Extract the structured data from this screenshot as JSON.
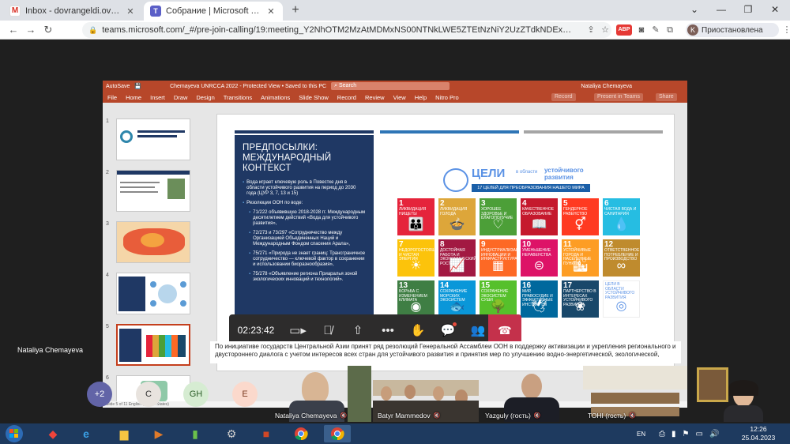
{
  "browser": {
    "tabs": [
      {
        "title": "Inbox - dovrangeldi.ovl@gmail.c",
        "favicon": "gmail-icon"
      },
      {
        "title": "Собрание | Microsoft Teams",
        "favicon": "teams-icon"
      }
    ],
    "url": "teams.microsoft.com/_#/pre-join-calling/19:meeting_Y2NhOTM2MzAtMDMxNS00NTNkLWE5ZTEtNzNiY2UzZTdkNDEx@thre...",
    "profile_initial": "K",
    "profile_label": "Приостановлена",
    "abp": "ABP"
  },
  "ppt": {
    "autosave": "AutoSave",
    "file_title": "Chemayeva UNRCCA 2022  -  Protected View  •  Saved to this PC",
    "search": "Search",
    "user": "Nataliya Chemayeva",
    "menu": [
      "File",
      "Home",
      "Insert",
      "Draw",
      "Design",
      "Transitions",
      "Animations",
      "Slide Show",
      "Record",
      "Review",
      "View",
      "Help",
      "Nitro Pro"
    ],
    "record_btn": "Record",
    "present_btn": "Present in Teams",
    "share_btn": "Share",
    "thumb_numbers": [
      "1",
      "2",
      "3",
      "4",
      "5",
      "6"
    ],
    "status": "Slide 5 of 11    English (United States)",
    "notes": "По инициативе государств Центральной Азии принят ряд резолюций Генеральной Ассамблеи ООН в поддержку активизации и укрепления регионального и двустороннего диалога с учетом интересов всех стран для устойчивого развития и принятия мер по улучшению водно-энергетической, экологической,"
  },
  "slide": {
    "title": "ПРЕДПОСЫЛКИ: МЕЖДУНАРОДНЫЙ КОНТЕКСТ",
    "bullets": [
      {
        "text": "Вода играет ключевую роль в Повестке дня в области устойчивого развития на период до 2030 года (ЦУР 3, 7, 13 и 15)",
        "sub": false
      },
      {
        "text": "Резолюции ООН по воде:",
        "sub": false
      },
      {
        "text": "71/222 объявившую 2018-2028 гг. Международным десятилетием действий «Вода для устойчивого развития»,",
        "sub": true
      },
      {
        "text": "72/273 и 73/297 «Сотрудничество между Организацией Объединенных Наций и Международным Фондом спасения Арала»,",
        "sub": true
      },
      {
        "text": "75/271 «Природа не знает границ: Трансграничное сотрудничество — ключевой фактор в сохранении и использовании биоразнообразия»,",
        "sub": true
      },
      {
        "text": "75/278 «Объявление региона Приаралья зоной экологических инноваций и технологий».",
        "sub": true
      }
    ],
    "sdg_word": "ЦЕЛИ",
    "sdg_in": "в области",
    "sdg_sust": "устойчивого развития",
    "sdg_band": "17 ЦЕЛЕЙ ДЛЯ ПРЕОБРАЗОВАНИЯ НАШЕГО МИРА",
    "goals": [
      {
        "n": "1",
        "t": "Ликвидация нищеты",
        "c": "#e5243b",
        "icon": "family-icon",
        "g": "👪"
      },
      {
        "n": "2",
        "t": "Ликвидация голода",
        "c": "#dda63a",
        "icon": "bowl-icon",
        "g": "🍲"
      },
      {
        "n": "3",
        "t": "Хорошее здоровье и благополучие",
        "c": "#4c9f38",
        "icon": "heartbeat-icon",
        "g": "♡"
      },
      {
        "n": "4",
        "t": "Качественное образование",
        "c": "#c5192d",
        "icon": "book-icon",
        "g": "📖"
      },
      {
        "n": "5",
        "t": "Гендерное равенство",
        "c": "#ff3a21",
        "icon": "gender-icon",
        "g": "⚥"
      },
      {
        "n": "6",
        "t": "Чистая вода и санитария",
        "c": "#26bde2",
        "icon": "water-icon",
        "g": "💧"
      },
      {
        "n": "7",
        "t": "Недорогостоящая и чистая энергия",
        "c": "#fcc30b",
        "icon": "sun-icon",
        "g": "☀"
      },
      {
        "n": "8",
        "t": "Достойная работа и экономический рост",
        "c": "#a21942",
        "icon": "growth-icon",
        "g": "📈"
      },
      {
        "n": "9",
        "t": "Индустриализация, инновации и инфраструктура",
        "c": "#fd6925",
        "icon": "cubes-icon",
        "g": "▦"
      },
      {
        "n": "10",
        "t": "Уменьшение неравенства",
        "c": "#dd1367",
        "icon": "equal-icon",
        "g": "⊜"
      },
      {
        "n": "11",
        "t": "Устойчивые города и населенные пункты",
        "c": "#fd9d24",
        "icon": "city-icon",
        "g": "🏙"
      },
      {
        "n": "12",
        "t": "Ответственное потребление и производство",
        "c": "#bf8b2e",
        "icon": "infinity-icon",
        "g": "∞"
      },
      {
        "n": "13",
        "t": "Борьба с изменением климата",
        "c": "#3f7e44",
        "icon": "eye-icon",
        "g": "◉"
      },
      {
        "n": "14",
        "t": "Сохранение морских экосистем",
        "c": "#0a97d9",
        "icon": "fish-icon",
        "g": "🐟"
      },
      {
        "n": "15",
        "t": "Сохранение экосистем суши",
        "c": "#56c02b",
        "icon": "tree-icon",
        "g": "🌳"
      },
      {
        "n": "16",
        "t": "Мир, правосудие и эффективные институты",
        "c": "#00689d",
        "icon": "dove-icon",
        "g": "🕊"
      },
      {
        "n": "17",
        "t": "Партнерство в интересах устойчивого развития",
        "c": "#19486a",
        "icon": "rings-icon",
        "g": "❀"
      },
      {
        "n": "",
        "t": "ЦЕЛИ В ОБЛАСТИ УСТОЙЧИВОГО РАЗВИТИЯ",
        "c": "#ffffff",
        "icon": "sdg-logo",
        "g": "◎"
      }
    ]
  },
  "call": {
    "timer": "02:23:42",
    "presenter": "Nataliya Chemayeva",
    "avatars": [
      {
        "label": "+2",
        "bg": "#6264a7",
        "fg": "#ffffff"
      },
      {
        "label": "C",
        "bg": "#e8e3de",
        "fg": "#333333"
      },
      {
        "label": "GH",
        "bg": "#d6ecd2",
        "fg": "#2d5f2a"
      },
      {
        "label": "E",
        "bg": "#fbd9cc",
        "fg": "#7a3a20"
      }
    ],
    "videos": [
      {
        "name": "Nataliya Chemayeva",
        "bg": "#8a7a66"
      },
      {
        "name": "Batyr Mammedov",
        "bg": "#6d6256"
      },
      {
        "name": "Yazguly (гость)",
        "bg": "#94979c"
      },
      {
        "name": "ТОНІ (гость)",
        "bg": "#b0a58e"
      },
      {
        "name": "",
        "bg": "#d9cfc3"
      }
    ]
  },
  "taskbar": {
    "lang": "EN",
    "time": "12:26",
    "date": "25.04.2023"
  }
}
